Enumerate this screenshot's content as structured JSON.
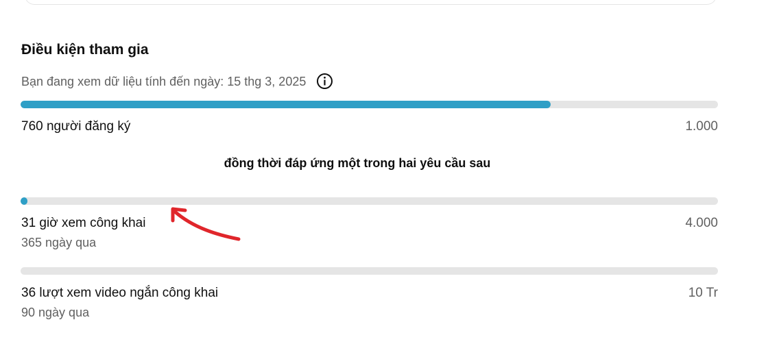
{
  "section": {
    "title": "Điều kiện tham gia",
    "data_date_text": "Bạn đang xem dữ liệu tính đến ngày: 15 thg 3, 2025",
    "info_icon": "info-icon"
  },
  "requirements": {
    "subscribers": {
      "label": "760 người đăng ký",
      "target": "1.000",
      "progress_fraction": 0.76
    },
    "alternative_note": "đồng thời đáp ứng một trong hai yêu cầu sau",
    "watch_hours": {
      "label": "31 giờ xem công khai",
      "sub": "365 ngày qua",
      "target": "4.000",
      "progress_fraction": 0.00775
    },
    "shorts_views": {
      "label": "36 lượt xem video ngắn công khai",
      "sub": "90 ngày qua",
      "target": "10 Tr",
      "progress_fraction": 3.6e-06
    }
  },
  "colors": {
    "progress_fill": "#2f9fc6",
    "progress_track": "#e5e5e5",
    "annotation_arrow": "#e0262b"
  }
}
